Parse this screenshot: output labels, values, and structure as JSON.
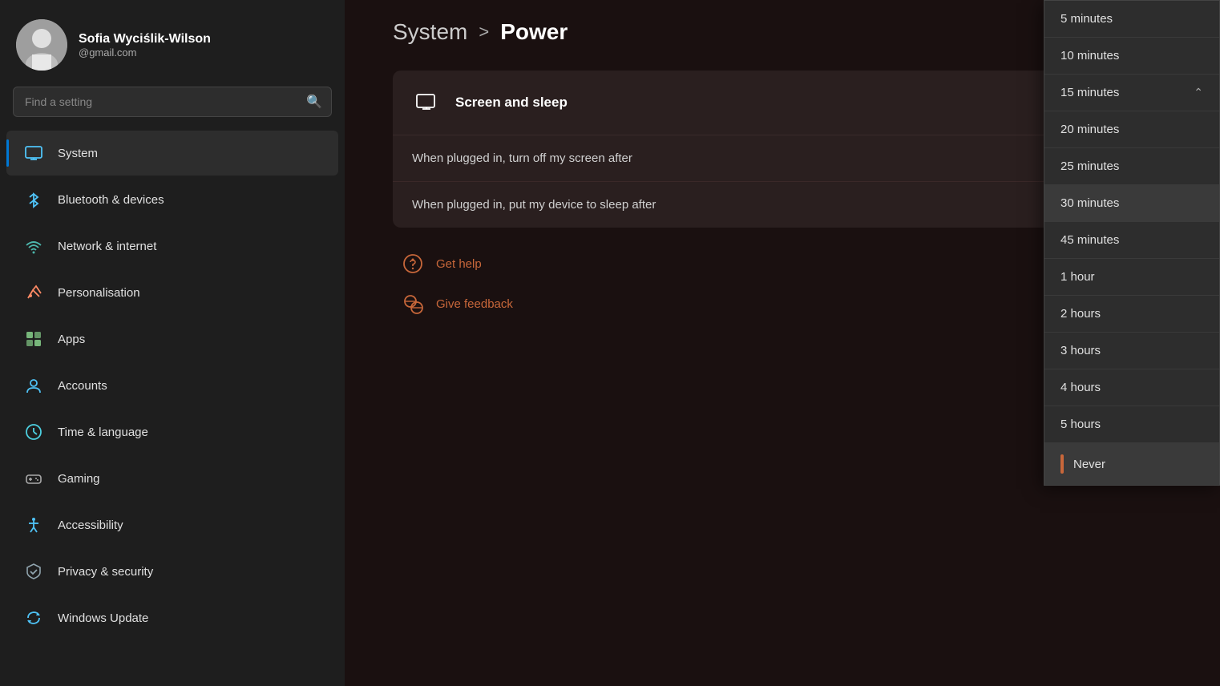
{
  "sidebar": {
    "user": {
      "name": "Sofia Wyciślik-Wilson",
      "email": "@gmail.com"
    },
    "search": {
      "placeholder": "Find a setting"
    },
    "nav": [
      {
        "id": "system",
        "label": "System",
        "active": true,
        "iconColor": "#4fc3f7"
      },
      {
        "id": "bluetooth",
        "label": "Bluetooth & devices",
        "active": false,
        "iconColor": "#4fc3f7"
      },
      {
        "id": "network",
        "label": "Network & internet",
        "active": false,
        "iconColor": "#4db6ac"
      },
      {
        "id": "personalisation",
        "label": "Personalisation",
        "active": false,
        "iconColor": "#ff8a65"
      },
      {
        "id": "apps",
        "label": "Apps",
        "active": false,
        "iconColor": "#81c784"
      },
      {
        "id": "accounts",
        "label": "Accounts",
        "active": false,
        "iconColor": "#4fc3f7"
      },
      {
        "id": "time",
        "label": "Time & language",
        "active": false,
        "iconColor": "#4dd0e1"
      },
      {
        "id": "gaming",
        "label": "Gaming",
        "active": false,
        "iconColor": "#888"
      },
      {
        "id": "accessibility",
        "label": "Accessibility",
        "active": false,
        "iconColor": "#4fc3f7"
      },
      {
        "id": "privacy",
        "label": "Privacy & security",
        "active": false,
        "iconColor": "#90a4ae"
      },
      {
        "id": "update",
        "label": "Windows Update",
        "active": false,
        "iconColor": "#4fc3f7"
      }
    ]
  },
  "main": {
    "breadcrumb": {
      "parent": "System",
      "separator": ">",
      "current": "Power"
    },
    "section": {
      "title": "Screen and sleep",
      "rows": [
        {
          "label": "When plugged in, turn off my screen after"
        },
        {
          "label": "When plugged in, put my device to sleep after"
        }
      ]
    },
    "helpLinks": [
      {
        "id": "help",
        "label": "Get help"
      },
      {
        "id": "feedback",
        "label": "Give feedback"
      }
    ]
  },
  "dropdown": {
    "items": [
      {
        "label": "5 minutes",
        "selected": false
      },
      {
        "label": "10 minutes",
        "selected": false
      },
      {
        "label": "15 minutes",
        "selected": false
      },
      {
        "label": "20 minutes",
        "selected": false
      },
      {
        "label": "25 minutes",
        "selected": false
      },
      {
        "label": "30 minutes",
        "selected": true
      },
      {
        "label": "45 minutes",
        "selected": false
      },
      {
        "label": "1 hour",
        "selected": false
      },
      {
        "label": "2 hours",
        "selected": false
      },
      {
        "label": "3 hours",
        "selected": false
      },
      {
        "label": "4 hours",
        "selected": false
      },
      {
        "label": "5 hours",
        "selected": false
      },
      {
        "label": "Never",
        "selected": false,
        "highlighted": true
      }
    ]
  }
}
